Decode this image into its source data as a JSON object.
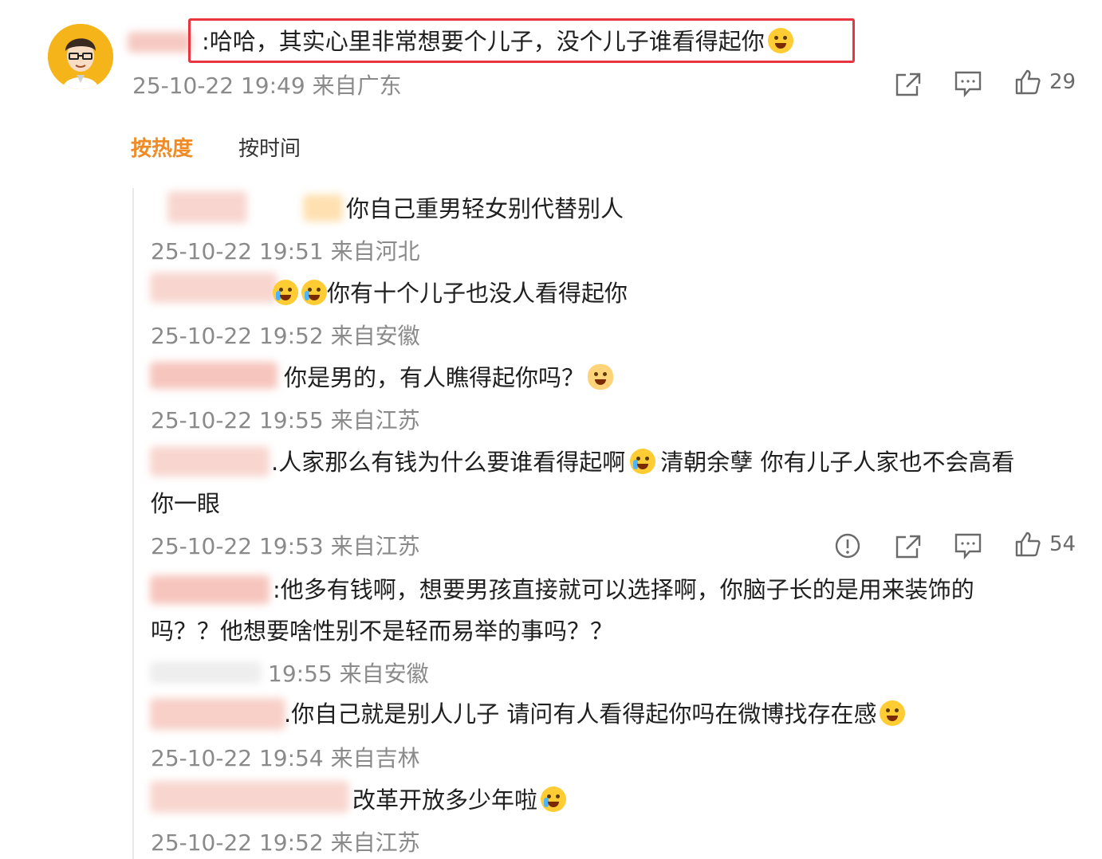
{
  "main_comment": {
    "text": ":哈哈，其实心里非常想要个儿子，没个儿子谁看得起你",
    "timestamp": "25-10-22 19:49",
    "location": "来自广东",
    "like_count": "29",
    "highlight_color": "#e8353f"
  },
  "sort": {
    "hot": "按热度",
    "time": "按时间",
    "active_color": "#f08a24"
  },
  "replies": [
    {
      "text": "你自己重男轻女别代替别人",
      "timestamp": "25-10-22 19:51",
      "location": "来自河北"
    },
    {
      "text": "你有十个儿子也没人看得起你",
      "timestamp": "25-10-22 19:52",
      "location": "来自安徽"
    },
    {
      "text": "你是男的，有人瞧得起你吗？",
      "timestamp": "25-10-22 19:55",
      "location": "来自江苏"
    },
    {
      "text": ".人家那么有钱为什么要谁看得起啊",
      "text_b": "清朝余孽 你有儿子人家也不会高看",
      "text_line2": "你一眼",
      "timestamp": "25-10-22 19:53",
      "location": "来自江苏",
      "like_count": "54"
    },
    {
      "text": ":他多有钱啊，想要男孩直接就可以选择啊，你脑子长的是用来装饰的",
      "text_line2": "吗？？他想要啥性别不是轻而易举的事吗？？",
      "timestamp": "19:55",
      "location": "来自安徽"
    },
    {
      "text": ".你自己就是别人儿子 请问有人看得起你吗在微博找存在感",
      "timestamp": "25-10-22 19:54",
      "location": "来自吉林"
    },
    {
      "text": "改革开放多少年啦",
      "timestamp": "25-10-22 19:52",
      "location": "来自江苏"
    }
  ],
  "icons": {
    "share": "share-icon",
    "comment": "comment-icon",
    "like": "thumbs-up-icon",
    "report": "report-icon"
  }
}
